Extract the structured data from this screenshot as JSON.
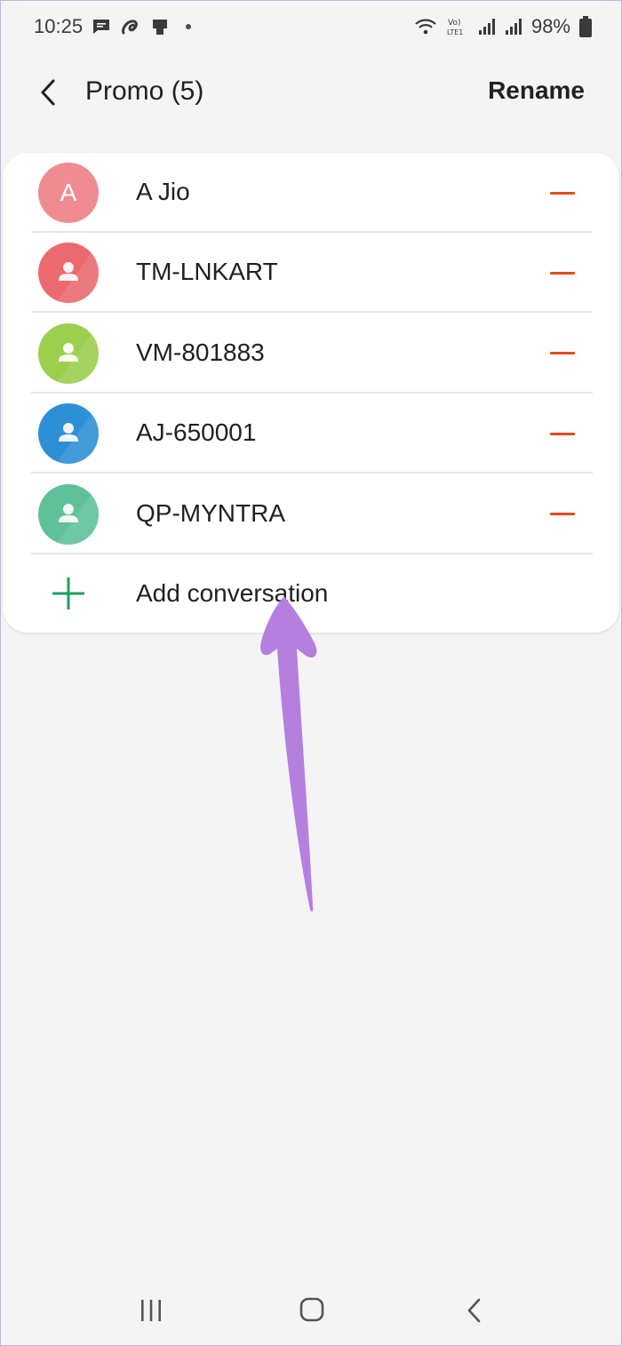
{
  "status_bar": {
    "time": "10:25",
    "battery": "98%",
    "icons": [
      "message-icon",
      "airtel-icon",
      "device-icon",
      "wifi-icon",
      "volte-icon",
      "signal-icon",
      "signal-icon",
      "battery-icon"
    ]
  },
  "header": {
    "title": "Promo (5)",
    "rename_label": "Rename",
    "back_icon": "chevron-left-icon"
  },
  "conversations": [
    {
      "name": "A Jio",
      "avatar_letter": "A",
      "avatar_color": "#f08b92"
    },
    {
      "name": "TM-LNKART",
      "avatar_letter": "",
      "avatar_color": "#ea6a6f"
    },
    {
      "name": "VM-801883",
      "avatar_letter": "",
      "avatar_color": "#9ccf4e"
    },
    {
      "name": "AJ-650001",
      "avatar_letter": "",
      "avatar_color": "#2d8fd5"
    },
    {
      "name": "QP-MYNTRA",
      "avatar_letter": "",
      "avatar_color": "#5fc19a"
    }
  ],
  "add_conversation": {
    "label": "Add conversation",
    "icon": "plus-icon",
    "color": "#1aa35c"
  },
  "remove_color": "#e64a19",
  "annotation_arrow_color": "#b57fe0",
  "nav_bar": {
    "icons": [
      "recent-apps-icon",
      "home-icon",
      "back-icon"
    ]
  }
}
